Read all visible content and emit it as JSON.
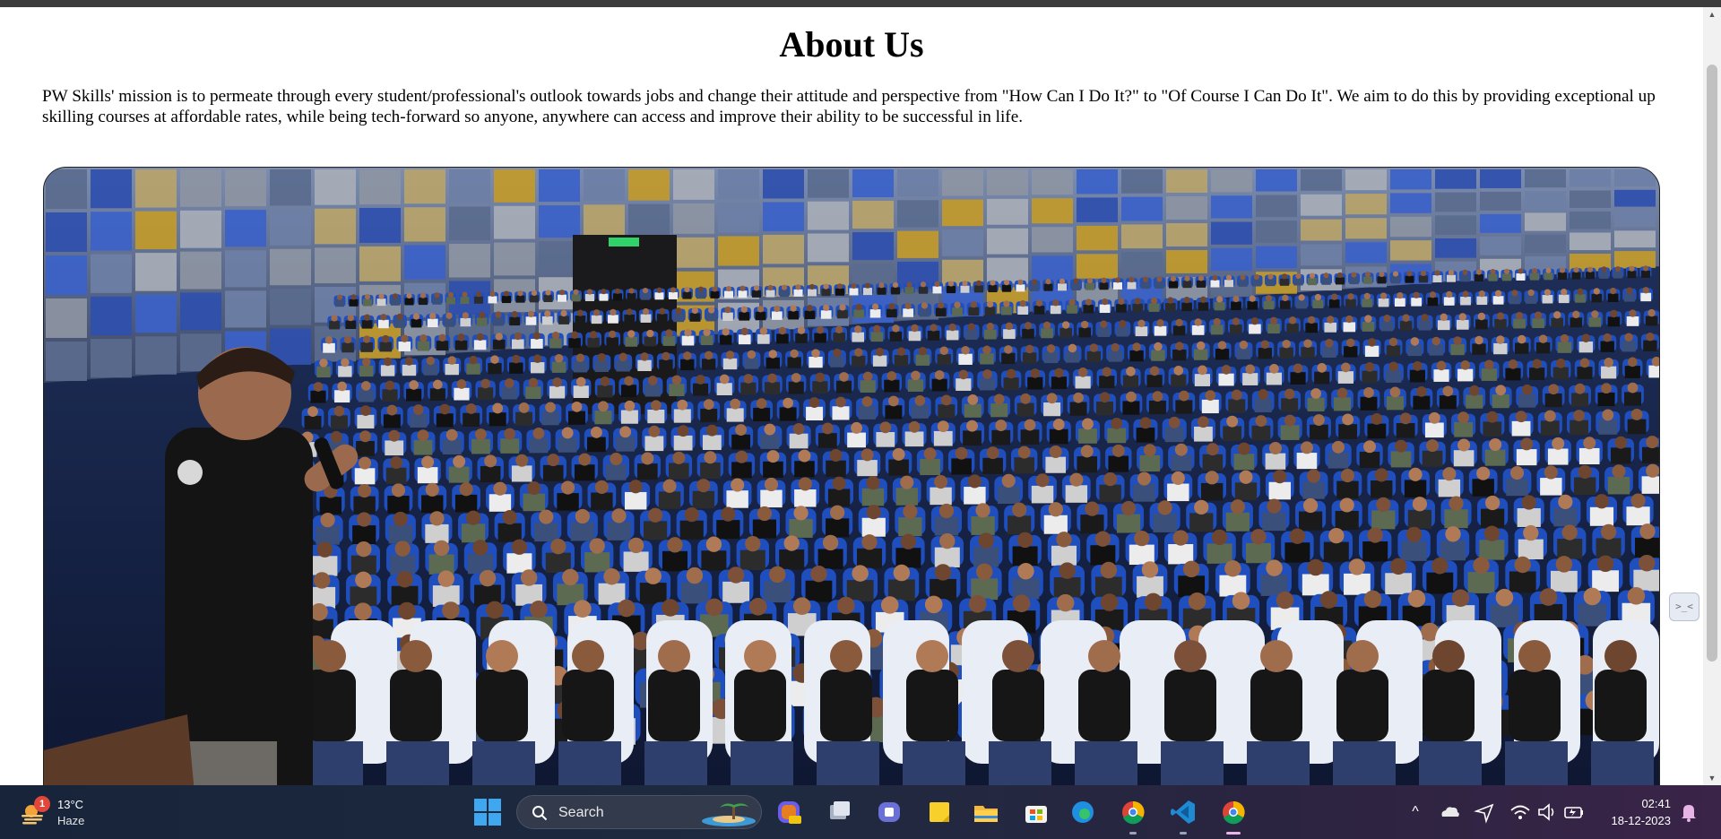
{
  "page": {
    "title": "About Us",
    "mission": "PW Skills' mission is to permeate through every student/professional's outlook towards jobs and change their attitude and perspective from \"How Can I Do It?\" to \"Of Course I Can Do It\". We aim to do this by providing exceptional up skilling courses at affordable rates, while being tech-forward so anyone, anywhere can access and improve their ability to be successful in life."
  },
  "hero_image": {
    "semantic": "auditorium-audience-photo"
  },
  "scrollbar": {
    "up_glyph": "▲",
    "down_glyph": "▼"
  },
  "side_widget": {
    "glyph": ">_<"
  },
  "taskbar": {
    "weather": {
      "badge": "1",
      "temperature": "13°C",
      "condition": "Haze",
      "icon": "sun-haze-icon"
    },
    "search_label": "Search",
    "pinned_apps": [
      {
        "name": "copilot-icon"
      },
      {
        "name": "task-view-icon"
      },
      {
        "name": "teams-chat-icon"
      },
      {
        "name": "sticky-notes-icon"
      },
      {
        "name": "file-explorer-icon"
      },
      {
        "name": "microsoft-store-icon"
      },
      {
        "name": "edge-icon"
      },
      {
        "name": "chrome-beta-icon"
      },
      {
        "name": "vscode-icon"
      },
      {
        "name": "chrome-icon"
      }
    ],
    "tray": {
      "chevron": "^",
      "icons": [
        "onedrive-icon",
        "location-icon",
        "wifi-icon",
        "volume-icon",
        "battery-icon"
      ]
    },
    "clock": {
      "time": "02:41",
      "date": "18-12-2023"
    }
  },
  "colors": {
    "taskbar_start": "#17243a",
    "taskbar_end": "#3a2448",
    "seat_blue": "#1f4fbf",
    "seat_white": "#e9edf5"
  }
}
